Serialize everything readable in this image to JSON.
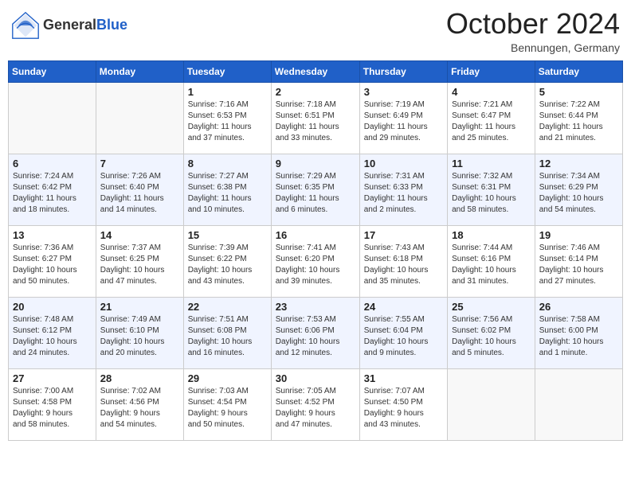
{
  "header": {
    "logo_general": "General",
    "logo_blue": "Blue",
    "month": "October 2024",
    "location": "Bennungen, Germany"
  },
  "columns": [
    "Sunday",
    "Monday",
    "Tuesday",
    "Wednesday",
    "Thursday",
    "Friday",
    "Saturday"
  ],
  "weeks": [
    [
      {
        "day": "",
        "info": ""
      },
      {
        "day": "",
        "info": ""
      },
      {
        "day": "1",
        "info": "Sunrise: 7:16 AM\nSunset: 6:53 PM\nDaylight: 11 hours\nand 37 minutes."
      },
      {
        "day": "2",
        "info": "Sunrise: 7:18 AM\nSunset: 6:51 PM\nDaylight: 11 hours\nand 33 minutes."
      },
      {
        "day": "3",
        "info": "Sunrise: 7:19 AM\nSunset: 6:49 PM\nDaylight: 11 hours\nand 29 minutes."
      },
      {
        "day": "4",
        "info": "Sunrise: 7:21 AM\nSunset: 6:47 PM\nDaylight: 11 hours\nand 25 minutes."
      },
      {
        "day": "5",
        "info": "Sunrise: 7:22 AM\nSunset: 6:44 PM\nDaylight: 11 hours\nand 21 minutes."
      }
    ],
    [
      {
        "day": "6",
        "info": "Sunrise: 7:24 AM\nSunset: 6:42 PM\nDaylight: 11 hours\nand 18 minutes."
      },
      {
        "day": "7",
        "info": "Sunrise: 7:26 AM\nSunset: 6:40 PM\nDaylight: 11 hours\nand 14 minutes."
      },
      {
        "day": "8",
        "info": "Sunrise: 7:27 AM\nSunset: 6:38 PM\nDaylight: 11 hours\nand 10 minutes."
      },
      {
        "day": "9",
        "info": "Sunrise: 7:29 AM\nSunset: 6:35 PM\nDaylight: 11 hours\nand 6 minutes."
      },
      {
        "day": "10",
        "info": "Sunrise: 7:31 AM\nSunset: 6:33 PM\nDaylight: 11 hours\nand 2 minutes."
      },
      {
        "day": "11",
        "info": "Sunrise: 7:32 AM\nSunset: 6:31 PM\nDaylight: 10 hours\nand 58 minutes."
      },
      {
        "day": "12",
        "info": "Sunrise: 7:34 AM\nSunset: 6:29 PM\nDaylight: 10 hours\nand 54 minutes."
      }
    ],
    [
      {
        "day": "13",
        "info": "Sunrise: 7:36 AM\nSunset: 6:27 PM\nDaylight: 10 hours\nand 50 minutes."
      },
      {
        "day": "14",
        "info": "Sunrise: 7:37 AM\nSunset: 6:25 PM\nDaylight: 10 hours\nand 47 minutes."
      },
      {
        "day": "15",
        "info": "Sunrise: 7:39 AM\nSunset: 6:22 PM\nDaylight: 10 hours\nand 43 minutes."
      },
      {
        "day": "16",
        "info": "Sunrise: 7:41 AM\nSunset: 6:20 PM\nDaylight: 10 hours\nand 39 minutes."
      },
      {
        "day": "17",
        "info": "Sunrise: 7:43 AM\nSunset: 6:18 PM\nDaylight: 10 hours\nand 35 minutes."
      },
      {
        "day": "18",
        "info": "Sunrise: 7:44 AM\nSunset: 6:16 PM\nDaylight: 10 hours\nand 31 minutes."
      },
      {
        "day": "19",
        "info": "Sunrise: 7:46 AM\nSunset: 6:14 PM\nDaylight: 10 hours\nand 27 minutes."
      }
    ],
    [
      {
        "day": "20",
        "info": "Sunrise: 7:48 AM\nSunset: 6:12 PM\nDaylight: 10 hours\nand 24 minutes."
      },
      {
        "day": "21",
        "info": "Sunrise: 7:49 AM\nSunset: 6:10 PM\nDaylight: 10 hours\nand 20 minutes."
      },
      {
        "day": "22",
        "info": "Sunrise: 7:51 AM\nSunset: 6:08 PM\nDaylight: 10 hours\nand 16 minutes."
      },
      {
        "day": "23",
        "info": "Sunrise: 7:53 AM\nSunset: 6:06 PM\nDaylight: 10 hours\nand 12 minutes."
      },
      {
        "day": "24",
        "info": "Sunrise: 7:55 AM\nSunset: 6:04 PM\nDaylight: 10 hours\nand 9 minutes."
      },
      {
        "day": "25",
        "info": "Sunrise: 7:56 AM\nSunset: 6:02 PM\nDaylight: 10 hours\nand 5 minutes."
      },
      {
        "day": "26",
        "info": "Sunrise: 7:58 AM\nSunset: 6:00 PM\nDaylight: 10 hours\nand 1 minute."
      }
    ],
    [
      {
        "day": "27",
        "info": "Sunrise: 7:00 AM\nSunset: 4:58 PM\nDaylight: 9 hours\nand 58 minutes."
      },
      {
        "day": "28",
        "info": "Sunrise: 7:02 AM\nSunset: 4:56 PM\nDaylight: 9 hours\nand 54 minutes."
      },
      {
        "day": "29",
        "info": "Sunrise: 7:03 AM\nSunset: 4:54 PM\nDaylight: 9 hours\nand 50 minutes."
      },
      {
        "day": "30",
        "info": "Sunrise: 7:05 AM\nSunset: 4:52 PM\nDaylight: 9 hours\nand 47 minutes."
      },
      {
        "day": "31",
        "info": "Sunrise: 7:07 AM\nSunset: 4:50 PM\nDaylight: 9 hours\nand 43 minutes."
      },
      {
        "day": "",
        "info": ""
      },
      {
        "day": "",
        "info": ""
      }
    ]
  ]
}
